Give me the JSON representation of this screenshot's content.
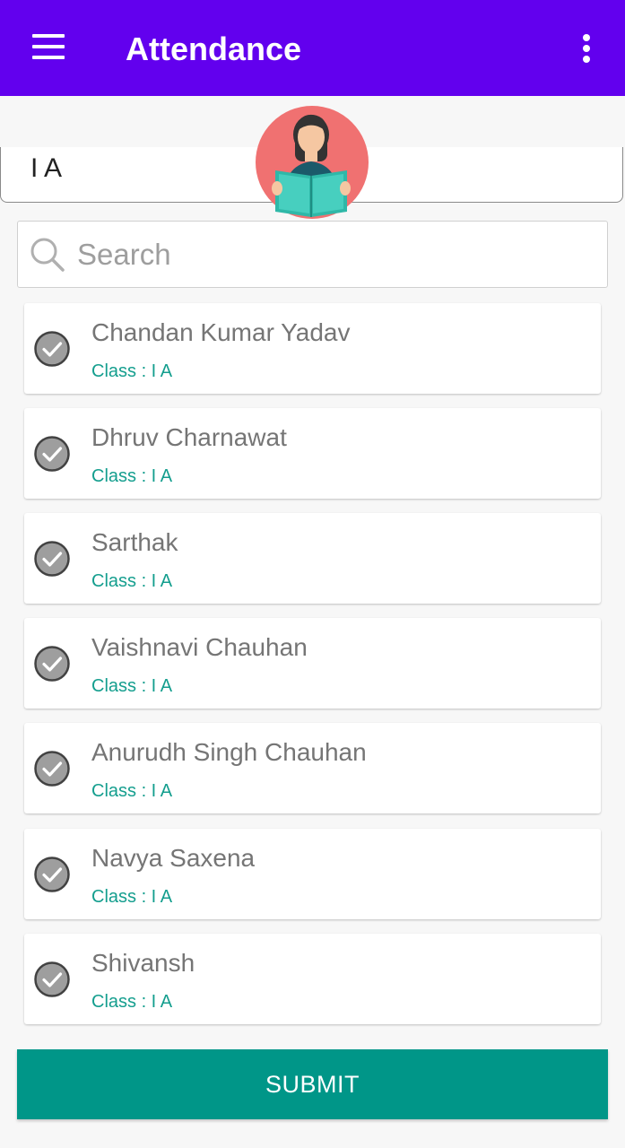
{
  "appbar": {
    "title": "Attendance",
    "menu_icon": "hamburger-menu-icon",
    "more_icon": "more-vertical-icon",
    "color": "#6200ee"
  },
  "class_selector": {
    "value": "I  A",
    "avatar_icon": "teacher-reading-book-avatar"
  },
  "search": {
    "placeholder": "Search",
    "icon": "search-icon"
  },
  "students": [
    {
      "name": "Chandan Kumar Yadav",
      "class_label": "Class : I  A",
      "checked": true
    },
    {
      "name": "Dhruv Charnawat",
      "class_label": "Class : I  A",
      "checked": true
    },
    {
      "name": "Sarthak",
      "class_label": "Class : I  A",
      "checked": true
    },
    {
      "name": "Vaishnavi Chauhan",
      "class_label": "Class : I  A",
      "checked": true
    },
    {
      "name": "Anurudh Singh Chauhan",
      "class_label": "Class : I  A",
      "checked": true
    },
    {
      "name": "Navya Saxena",
      "class_label": "Class : I  A",
      "checked": true
    },
    {
      "name": "Shivansh",
      "class_label": "Class : I  A",
      "checked": true
    }
  ],
  "submit": {
    "label": "SUBMIT",
    "color": "#009688"
  }
}
